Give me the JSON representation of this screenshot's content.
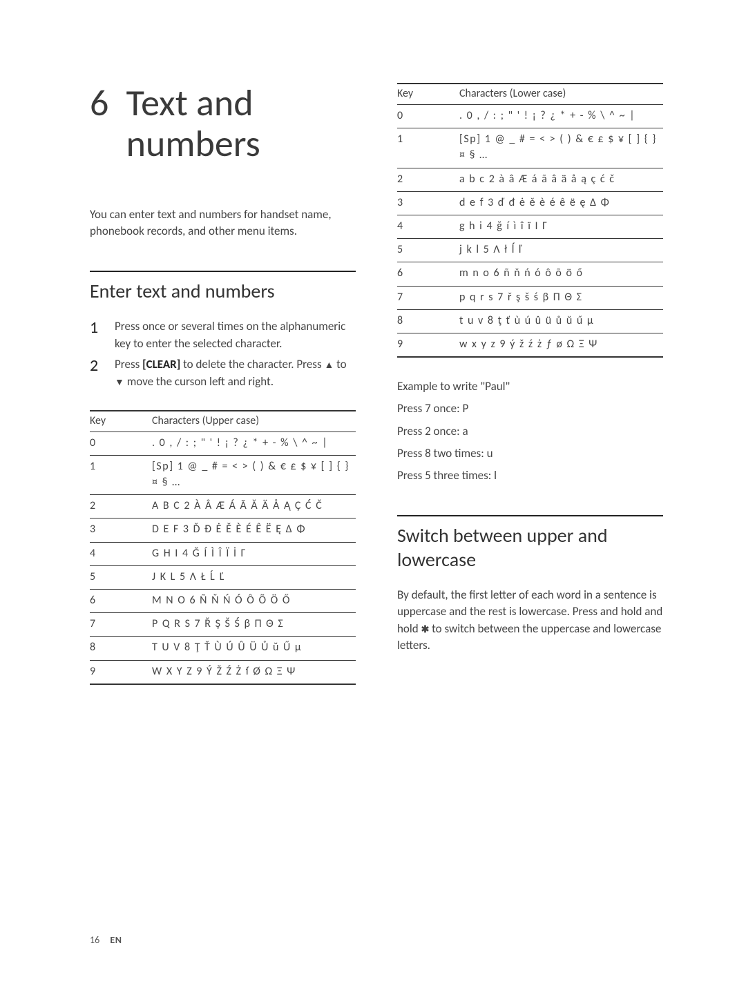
{
  "chapter": {
    "number": "6",
    "title_line1": "Text and",
    "title_line2": "numbers"
  },
  "intro": "You can enter text and numbers for handset name, phonebook records, and other menu items.",
  "section1": {
    "title": "Enter text and numbers",
    "step1": "Press once or several times on the alphanumeric key to enter the selected character.",
    "step2_pre": "Press ",
    "step2_clear": "[CLEAR]",
    "step2_mid": " to delete the character. Press ",
    "step2_to": " to ",
    "step2_post": " move the curson left and right."
  },
  "table_upper": {
    "header_key": "Key",
    "header_chars": "Characters (Upper case)",
    "rows": [
      {
        "k": "0",
        "c": ". 0 , / : ; \" ' ! ¡ ? ¿ * + - % \\ ^ ~ |"
      },
      {
        "k": "1",
        "c": "[Sp] 1 @ _ # = < > ( ) & € £ $ ¥ [ ] { } ¤ § …"
      },
      {
        "k": "2",
        "c": "A B C 2 À Â Æ Á Ã Ă Ä Å Ą Ç Ć Č"
      },
      {
        "k": "3",
        "c": "D E F 3 Ď Đ Ė Ě È É Ê Ë Ę Δ Φ"
      },
      {
        "k": "4",
        "c": "G H I 4 Ğ Í Ì Î Ï İ Γ"
      },
      {
        "k": "5",
        "c": "J K L 5 Λ Ł Ĺ Ľ"
      },
      {
        "k": "6",
        "c": "M N O 6 Ñ Ň Ń Ó Ô Õ Ö Ő"
      },
      {
        "k": "7",
        "c": "P Q R S 7 Ř Ş Š Ś β Π Θ Σ"
      },
      {
        "k": "8",
        "c": "T U V 8 Ţ Ť Ù Ú Û Ü Ů ŭ Ű μ"
      },
      {
        "k": "9",
        "c": "W X Y Z 9 Ý Ž Ź Ż ſ Ø Ω Ξ Ψ"
      }
    ]
  },
  "table_lower": {
    "header_key": "Key",
    "header_chars": "Characters (Lower case)",
    "rows": [
      {
        "k": "0",
        "c": ". 0 , / : ; \" ' ! ¡ ? ¿ * + - % \\ ^ ~ |"
      },
      {
        "k": "1",
        "c": "[Sp] 1 @ _ # = < > ( ) & € £ $ ¥ [ ] { } ¤ § …"
      },
      {
        "k": "2",
        "c": "a b c 2 à â Æ á ã â ä å ą ç ć č"
      },
      {
        "k": "3",
        "c": "d e f 3 ď đ ė ě è é ê ë ę Δ Φ"
      },
      {
        "k": "4",
        "c": "g h i 4 ğ í ì î ï I Γ"
      },
      {
        "k": "5",
        "c": "j k l 5 Λ ł ĺ ľ"
      },
      {
        "k": "6",
        "c": "m n o 6 ñ ň ń ó ô õ ö ő"
      },
      {
        "k": "7",
        "c": "p q r s 7 ř ş š ś β Π Θ Σ"
      },
      {
        "k": "8",
        "c": "t u v 8 ţ ť ù ú û ü ů ŭ ű μ"
      },
      {
        "k": "9",
        "c": "w x y z 9 ý ž ź ż ƒ ø Ω Ξ Ψ"
      }
    ]
  },
  "example": {
    "intro": "Example to write \"Paul\"",
    "l1": "Press 7 once: P",
    "l2": "Press 2 once: a",
    "l3": "Press 8 two times: u",
    "l4": "Press 5 three times: l"
  },
  "section2": {
    "title": "Switch between upper and lowercase",
    "body_pre": "By default, the first letter of each word in a sentence is uppercase and the rest is lowercase. Press and hold and hold ",
    "body_post": " to switch between the uppercase and lowercase letters."
  },
  "footer": {
    "page": "16",
    "lang": "EN"
  }
}
